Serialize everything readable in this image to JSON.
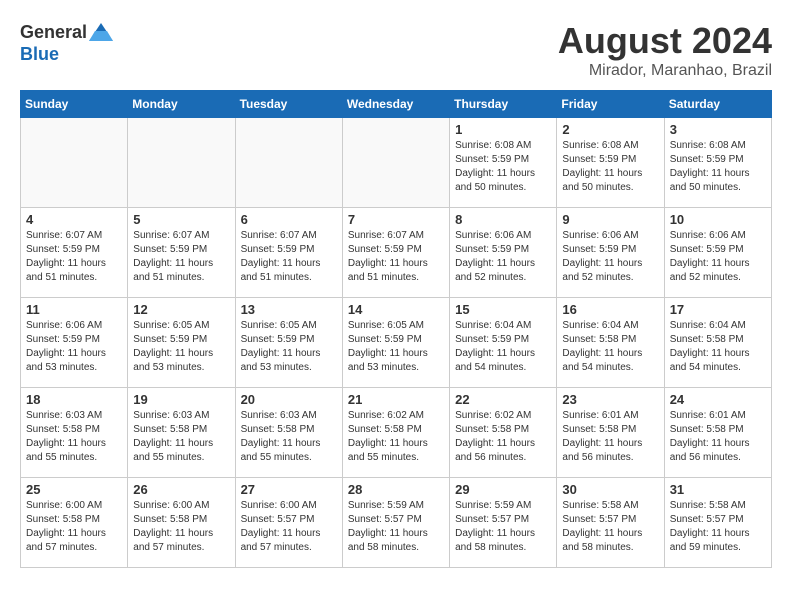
{
  "logo": {
    "general": "General",
    "blue": "Blue"
  },
  "title": "August 2024",
  "subtitle": "Mirador, Maranhao, Brazil",
  "days_of_week": [
    "Sunday",
    "Monday",
    "Tuesday",
    "Wednesday",
    "Thursday",
    "Friday",
    "Saturday"
  ],
  "weeks": [
    [
      {
        "day": "",
        "info": ""
      },
      {
        "day": "",
        "info": ""
      },
      {
        "day": "",
        "info": ""
      },
      {
        "day": "",
        "info": ""
      },
      {
        "day": "1",
        "info": "Sunrise: 6:08 AM\nSunset: 5:59 PM\nDaylight: 11 hours and 50 minutes."
      },
      {
        "day": "2",
        "info": "Sunrise: 6:08 AM\nSunset: 5:59 PM\nDaylight: 11 hours and 50 minutes."
      },
      {
        "day": "3",
        "info": "Sunrise: 6:08 AM\nSunset: 5:59 PM\nDaylight: 11 hours and 50 minutes."
      }
    ],
    [
      {
        "day": "4",
        "info": "Sunrise: 6:07 AM\nSunset: 5:59 PM\nDaylight: 11 hours and 51 minutes."
      },
      {
        "day": "5",
        "info": "Sunrise: 6:07 AM\nSunset: 5:59 PM\nDaylight: 11 hours and 51 minutes."
      },
      {
        "day": "6",
        "info": "Sunrise: 6:07 AM\nSunset: 5:59 PM\nDaylight: 11 hours and 51 minutes."
      },
      {
        "day": "7",
        "info": "Sunrise: 6:07 AM\nSunset: 5:59 PM\nDaylight: 11 hours and 51 minutes."
      },
      {
        "day": "8",
        "info": "Sunrise: 6:06 AM\nSunset: 5:59 PM\nDaylight: 11 hours and 52 minutes."
      },
      {
        "day": "9",
        "info": "Sunrise: 6:06 AM\nSunset: 5:59 PM\nDaylight: 11 hours and 52 minutes."
      },
      {
        "day": "10",
        "info": "Sunrise: 6:06 AM\nSunset: 5:59 PM\nDaylight: 11 hours and 52 minutes."
      }
    ],
    [
      {
        "day": "11",
        "info": "Sunrise: 6:06 AM\nSunset: 5:59 PM\nDaylight: 11 hours and 53 minutes."
      },
      {
        "day": "12",
        "info": "Sunrise: 6:05 AM\nSunset: 5:59 PM\nDaylight: 11 hours and 53 minutes."
      },
      {
        "day": "13",
        "info": "Sunrise: 6:05 AM\nSunset: 5:59 PM\nDaylight: 11 hours and 53 minutes."
      },
      {
        "day": "14",
        "info": "Sunrise: 6:05 AM\nSunset: 5:59 PM\nDaylight: 11 hours and 53 minutes."
      },
      {
        "day": "15",
        "info": "Sunrise: 6:04 AM\nSunset: 5:59 PM\nDaylight: 11 hours and 54 minutes."
      },
      {
        "day": "16",
        "info": "Sunrise: 6:04 AM\nSunset: 5:58 PM\nDaylight: 11 hours and 54 minutes."
      },
      {
        "day": "17",
        "info": "Sunrise: 6:04 AM\nSunset: 5:58 PM\nDaylight: 11 hours and 54 minutes."
      }
    ],
    [
      {
        "day": "18",
        "info": "Sunrise: 6:03 AM\nSunset: 5:58 PM\nDaylight: 11 hours and 55 minutes."
      },
      {
        "day": "19",
        "info": "Sunrise: 6:03 AM\nSunset: 5:58 PM\nDaylight: 11 hours and 55 minutes."
      },
      {
        "day": "20",
        "info": "Sunrise: 6:03 AM\nSunset: 5:58 PM\nDaylight: 11 hours and 55 minutes."
      },
      {
        "day": "21",
        "info": "Sunrise: 6:02 AM\nSunset: 5:58 PM\nDaylight: 11 hours and 55 minutes."
      },
      {
        "day": "22",
        "info": "Sunrise: 6:02 AM\nSunset: 5:58 PM\nDaylight: 11 hours and 56 minutes."
      },
      {
        "day": "23",
        "info": "Sunrise: 6:01 AM\nSunset: 5:58 PM\nDaylight: 11 hours and 56 minutes."
      },
      {
        "day": "24",
        "info": "Sunrise: 6:01 AM\nSunset: 5:58 PM\nDaylight: 11 hours and 56 minutes."
      }
    ],
    [
      {
        "day": "25",
        "info": "Sunrise: 6:00 AM\nSunset: 5:58 PM\nDaylight: 11 hours and 57 minutes."
      },
      {
        "day": "26",
        "info": "Sunrise: 6:00 AM\nSunset: 5:58 PM\nDaylight: 11 hours and 57 minutes."
      },
      {
        "day": "27",
        "info": "Sunrise: 6:00 AM\nSunset: 5:57 PM\nDaylight: 11 hours and 57 minutes."
      },
      {
        "day": "28",
        "info": "Sunrise: 5:59 AM\nSunset: 5:57 PM\nDaylight: 11 hours and 58 minutes."
      },
      {
        "day": "29",
        "info": "Sunrise: 5:59 AM\nSunset: 5:57 PM\nDaylight: 11 hours and 58 minutes."
      },
      {
        "day": "30",
        "info": "Sunrise: 5:58 AM\nSunset: 5:57 PM\nDaylight: 11 hours and 58 minutes."
      },
      {
        "day": "31",
        "info": "Sunrise: 5:58 AM\nSunset: 5:57 PM\nDaylight: 11 hours and 59 minutes."
      }
    ]
  ]
}
